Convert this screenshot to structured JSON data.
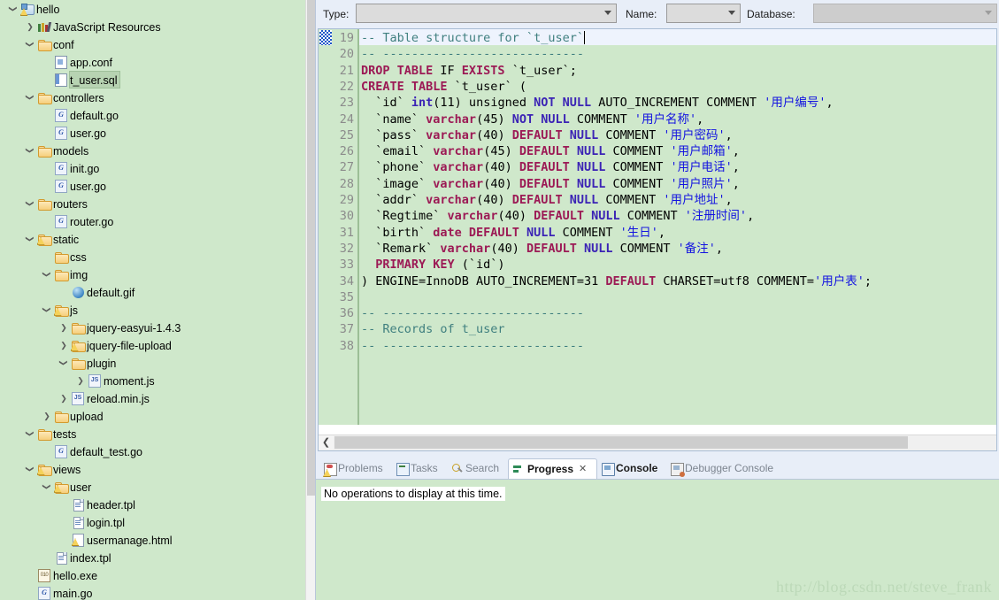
{
  "sidebar": {
    "scrollbar": "vertical-scrollbar",
    "tree": [
      {
        "depth": 0,
        "arrow": "v",
        "icon": "project-icon",
        "label": "hello",
        "selected": false
      },
      {
        "depth": 1,
        "arrow": ">",
        "icon": "library-icon",
        "label": "JavaScript Resources",
        "selected": false
      },
      {
        "depth": 1,
        "arrow": "v",
        "icon": "folder-icon",
        "label": "conf",
        "selected": false
      },
      {
        "depth": 2,
        "arrow": "",
        "icon": "conf-file-icon",
        "label": "app.conf",
        "selected": false
      },
      {
        "depth": 2,
        "arrow": "",
        "icon": "sql-file-icon",
        "label": "t_user.sql",
        "selected": true
      },
      {
        "depth": 1,
        "arrow": "v",
        "icon": "folder-icon",
        "label": "controllers",
        "selected": false
      },
      {
        "depth": 2,
        "arrow": "",
        "icon": "go-file-icon",
        "label": "default.go",
        "selected": false
      },
      {
        "depth": 2,
        "arrow": "",
        "icon": "go-file-icon",
        "label": "user.go",
        "selected": false
      },
      {
        "depth": 1,
        "arrow": "v",
        "icon": "folder-icon",
        "label": "models",
        "selected": false
      },
      {
        "depth": 2,
        "arrow": "",
        "icon": "go-file-icon",
        "label": "init.go",
        "selected": false
      },
      {
        "depth": 2,
        "arrow": "",
        "icon": "go-file-icon",
        "label": "user.go",
        "selected": false
      },
      {
        "depth": 1,
        "arrow": "v",
        "icon": "folder-icon",
        "label": "routers",
        "selected": false
      },
      {
        "depth": 2,
        "arrow": "",
        "icon": "go-file-icon",
        "label": "router.go",
        "selected": false
      },
      {
        "depth": 1,
        "arrow": "v",
        "icon": "folder-warn-icon",
        "label": "static",
        "selected": false
      },
      {
        "depth": 2,
        "arrow": "",
        "icon": "folder-icon",
        "label": "css",
        "selected": false
      },
      {
        "depth": 2,
        "arrow": "v",
        "icon": "folder-icon",
        "label": "img",
        "selected": false
      },
      {
        "depth": 3,
        "arrow": "",
        "icon": "gif-file-icon",
        "label": "default.gif",
        "selected": false
      },
      {
        "depth": 2,
        "arrow": "v",
        "icon": "folder-warn-icon",
        "label": "js",
        "selected": false
      },
      {
        "depth": 3,
        "arrow": ">",
        "icon": "folder-icon",
        "label": "jquery-easyui-1.4.3",
        "selected": false
      },
      {
        "depth": 3,
        "arrow": ">",
        "icon": "folder-warn-icon",
        "label": "jquery-file-upload",
        "selected": false
      },
      {
        "depth": 3,
        "arrow": "v",
        "icon": "folder-icon",
        "label": "plugin",
        "selected": false
      },
      {
        "depth": 4,
        "arrow": ">",
        "icon": "js-file-icon",
        "label": "moment.js",
        "selected": false
      },
      {
        "depth": 3,
        "arrow": ">",
        "icon": "js-file-icon",
        "label": "reload.min.js",
        "selected": false
      },
      {
        "depth": 2,
        "arrow": ">",
        "icon": "folder-icon",
        "label": "upload",
        "selected": false
      },
      {
        "depth": 1,
        "arrow": "v",
        "icon": "folder-icon",
        "label": "tests",
        "selected": false
      },
      {
        "depth": 2,
        "arrow": "",
        "icon": "go-file-icon",
        "label": "default_test.go",
        "selected": false
      },
      {
        "depth": 1,
        "arrow": "v",
        "icon": "folder-warn-icon",
        "label": "views",
        "selected": false
      },
      {
        "depth": 2,
        "arrow": "v",
        "icon": "folder-warn-icon",
        "label": "user",
        "selected": false
      },
      {
        "depth": 3,
        "arrow": "",
        "icon": "tpl-file-icon",
        "label": "header.tpl",
        "selected": false
      },
      {
        "depth": 3,
        "arrow": "",
        "icon": "tpl-file-icon",
        "label": "login.tpl",
        "selected": false
      },
      {
        "depth": 3,
        "arrow": "",
        "icon": "html-warn-icon",
        "label": "usermanage.html",
        "selected": false
      },
      {
        "depth": 2,
        "arrow": "",
        "icon": "tpl-file-icon",
        "label": "index.tpl",
        "selected": false
      },
      {
        "depth": 1,
        "arrow": "",
        "icon": "exe-file-icon",
        "label": "hello.exe",
        "selected": false
      },
      {
        "depth": 1,
        "arrow": "",
        "icon": "go-file-icon",
        "label": "main.go",
        "selected": false
      }
    ]
  },
  "toolbar": {
    "type_label": "Type:",
    "type_value": "",
    "type_placeholder": "",
    "name_label": "Name:",
    "name_value": "",
    "database_label": "Database:",
    "database_value": "",
    "database_disabled": true
  },
  "editor": {
    "current_line": 19,
    "first_line": 19,
    "lines": [
      {
        "n": 19,
        "tokens": [
          {
            "t": "-- Table structure for `t_user`",
            "c": "tk-comment"
          }
        ]
      },
      {
        "n": 20,
        "tokens": [
          {
            "t": "-- ----------------------------",
            "c": "tk-comment"
          }
        ]
      },
      {
        "n": 21,
        "tokens": [
          {
            "t": "DROP TABLE ",
            "c": "tk-kw"
          },
          {
            "t": "IF ",
            "c": "tk-plain"
          },
          {
            "t": "EXISTS ",
            "c": "tk-kw"
          },
          {
            "t": "`t_user`;",
            "c": "tk-plain"
          }
        ]
      },
      {
        "n": 22,
        "tokens": [
          {
            "t": "CREATE TABLE ",
            "c": "tk-kw"
          },
          {
            "t": "`t_user` (",
            "c": "tk-plain"
          }
        ]
      },
      {
        "n": 23,
        "tokens": [
          {
            "t": "  `id` ",
            "c": "tk-plain"
          },
          {
            "t": "int",
            "c": "tk-kw2"
          },
          {
            "t": "(11) unsigned ",
            "c": "tk-plain"
          },
          {
            "t": "NOT NULL ",
            "c": "tk-kw2"
          },
          {
            "t": "AUTO_INCREMENT COMMENT ",
            "c": "tk-plain"
          },
          {
            "t": "'用户编号'",
            "c": "tk-str"
          },
          {
            "t": ",",
            "c": "tk-plain"
          }
        ]
      },
      {
        "n": 24,
        "tokens": [
          {
            "t": "  `name` ",
            "c": "tk-plain"
          },
          {
            "t": "varchar",
            "c": "tk-kw"
          },
          {
            "t": "(45) ",
            "c": "tk-plain"
          },
          {
            "t": "NOT NULL ",
            "c": "tk-kw2"
          },
          {
            "t": "COMMENT ",
            "c": "tk-plain"
          },
          {
            "t": "'用户名称'",
            "c": "tk-str"
          },
          {
            "t": ",",
            "c": "tk-plain"
          }
        ]
      },
      {
        "n": 25,
        "tokens": [
          {
            "t": "  `pass` ",
            "c": "tk-plain"
          },
          {
            "t": "varchar",
            "c": "tk-kw"
          },
          {
            "t": "(40) ",
            "c": "tk-plain"
          },
          {
            "t": "DEFAULT ",
            "c": "tk-kw"
          },
          {
            "t": "NULL ",
            "c": "tk-kw2"
          },
          {
            "t": "COMMENT ",
            "c": "tk-plain"
          },
          {
            "t": "'用户密码'",
            "c": "tk-str"
          },
          {
            "t": ",",
            "c": "tk-plain"
          }
        ]
      },
      {
        "n": 26,
        "tokens": [
          {
            "t": "  `email` ",
            "c": "tk-plain"
          },
          {
            "t": "varchar",
            "c": "tk-kw"
          },
          {
            "t": "(45) ",
            "c": "tk-plain"
          },
          {
            "t": "DEFAULT ",
            "c": "tk-kw"
          },
          {
            "t": "NULL ",
            "c": "tk-kw2"
          },
          {
            "t": "COMMENT ",
            "c": "tk-plain"
          },
          {
            "t": "'用户邮箱'",
            "c": "tk-str"
          },
          {
            "t": ",",
            "c": "tk-plain"
          }
        ]
      },
      {
        "n": 27,
        "tokens": [
          {
            "t": "  `phone` ",
            "c": "tk-plain"
          },
          {
            "t": "varchar",
            "c": "tk-kw"
          },
          {
            "t": "(40) ",
            "c": "tk-plain"
          },
          {
            "t": "DEFAULT ",
            "c": "tk-kw"
          },
          {
            "t": "NULL ",
            "c": "tk-kw2"
          },
          {
            "t": "COMMENT ",
            "c": "tk-plain"
          },
          {
            "t": "'用户电话'",
            "c": "tk-str"
          },
          {
            "t": ",",
            "c": "tk-plain"
          }
        ]
      },
      {
        "n": 28,
        "tokens": [
          {
            "t": "  `image` ",
            "c": "tk-plain"
          },
          {
            "t": "varchar",
            "c": "tk-kw"
          },
          {
            "t": "(40) ",
            "c": "tk-plain"
          },
          {
            "t": "DEFAULT ",
            "c": "tk-kw"
          },
          {
            "t": "NULL ",
            "c": "tk-kw2"
          },
          {
            "t": "COMMENT ",
            "c": "tk-plain"
          },
          {
            "t": "'用户照片'",
            "c": "tk-str"
          },
          {
            "t": ",",
            "c": "tk-plain"
          }
        ]
      },
      {
        "n": 29,
        "tokens": [
          {
            "t": "  `addr` ",
            "c": "tk-plain"
          },
          {
            "t": "varchar",
            "c": "tk-kw"
          },
          {
            "t": "(40) ",
            "c": "tk-plain"
          },
          {
            "t": "DEFAULT ",
            "c": "tk-kw"
          },
          {
            "t": "NULL ",
            "c": "tk-kw2"
          },
          {
            "t": "COMMENT ",
            "c": "tk-plain"
          },
          {
            "t": "'用户地址'",
            "c": "tk-str"
          },
          {
            "t": ",",
            "c": "tk-plain"
          }
        ]
      },
      {
        "n": 30,
        "tokens": [
          {
            "t": "  `Regtime` ",
            "c": "tk-plain"
          },
          {
            "t": "varchar",
            "c": "tk-kw"
          },
          {
            "t": "(40) ",
            "c": "tk-plain"
          },
          {
            "t": "DEFAULT ",
            "c": "tk-kw"
          },
          {
            "t": "NULL ",
            "c": "tk-kw2"
          },
          {
            "t": "COMMENT ",
            "c": "tk-plain"
          },
          {
            "t": "'注册时间'",
            "c": "tk-str"
          },
          {
            "t": ",",
            "c": "tk-plain"
          }
        ]
      },
      {
        "n": 31,
        "tokens": [
          {
            "t": "  `birth` ",
            "c": "tk-plain"
          },
          {
            "t": "date ",
            "c": "tk-kw"
          },
          {
            "t": "DEFAULT ",
            "c": "tk-kw"
          },
          {
            "t": "NULL ",
            "c": "tk-kw2"
          },
          {
            "t": "COMMENT ",
            "c": "tk-plain"
          },
          {
            "t": "'生日'",
            "c": "tk-str"
          },
          {
            "t": ",",
            "c": "tk-plain"
          }
        ]
      },
      {
        "n": 32,
        "tokens": [
          {
            "t": "  `Remark` ",
            "c": "tk-plain"
          },
          {
            "t": "varchar",
            "c": "tk-kw"
          },
          {
            "t": "(40) ",
            "c": "tk-plain"
          },
          {
            "t": "DEFAULT ",
            "c": "tk-kw"
          },
          {
            "t": "NULL ",
            "c": "tk-kw2"
          },
          {
            "t": "COMMENT ",
            "c": "tk-plain"
          },
          {
            "t": "'备注'",
            "c": "tk-str"
          },
          {
            "t": ",",
            "c": "tk-plain"
          }
        ]
      },
      {
        "n": 33,
        "tokens": [
          {
            "t": "  PRIMARY KEY ",
            "c": "tk-kw"
          },
          {
            "t": "(`id`)",
            "c": "tk-plain"
          }
        ]
      },
      {
        "n": 34,
        "tokens": [
          {
            "t": ") ENGINE=InnoDB AUTO_INCREMENT=31 ",
            "c": "tk-plain"
          },
          {
            "t": "DEFAULT ",
            "c": "tk-kw"
          },
          {
            "t": "CHARSET=utf8 COMMENT=",
            "c": "tk-plain"
          },
          {
            "t": "'用户表'",
            "c": "tk-str"
          },
          {
            "t": ";",
            "c": "tk-plain"
          }
        ]
      },
      {
        "n": 35,
        "tokens": [
          {
            "t": "",
            "c": "tk-plain"
          }
        ]
      },
      {
        "n": 36,
        "tokens": [
          {
            "t": "-- ----------------------------",
            "c": "tk-comment"
          }
        ]
      },
      {
        "n": 37,
        "tokens": [
          {
            "t": "-- Records of t_user",
            "c": "tk-comment"
          }
        ]
      },
      {
        "n": 38,
        "tokens": [
          {
            "t": "-- ----------------------------",
            "c": "tk-comment"
          }
        ]
      }
    ],
    "hscrollbar": "horizontal-scrollbar"
  },
  "bottom_panel": {
    "tabs": [
      {
        "label": "Problems",
        "icon": "problems-icon",
        "active": false,
        "bold": false,
        "closable": false
      },
      {
        "label": "Tasks",
        "icon": "tasks-icon",
        "active": false,
        "bold": false,
        "closable": false
      },
      {
        "label": "Search",
        "icon": "search-icon",
        "active": false,
        "bold": false,
        "closable": false
      },
      {
        "label": "Progress",
        "icon": "progress-icon",
        "active": true,
        "bold": true,
        "closable": true
      },
      {
        "label": "Console",
        "icon": "console-icon",
        "active": false,
        "bold": true,
        "closable": false
      },
      {
        "label": "Debugger Console",
        "icon": "debug-icon",
        "active": false,
        "bold": false,
        "closable": false
      }
    ],
    "close_glyph": "✕",
    "message": "No operations to display at this time."
  },
  "watermark": "http://blog.csdn.net/steve_frank",
  "colors": {
    "tree_bg": "#cfe8cb",
    "editor_bg": "#cfe8cb",
    "chrome_bg": "#e8eef8",
    "selection": "#b7d3b2",
    "current_line": "#eef3fd",
    "keyword": "#9c1a55",
    "keyword2": "#3b23b5",
    "string": "#1414e0",
    "comment": "#3f7f7f",
    "line_number": "#8b8b8b"
  }
}
